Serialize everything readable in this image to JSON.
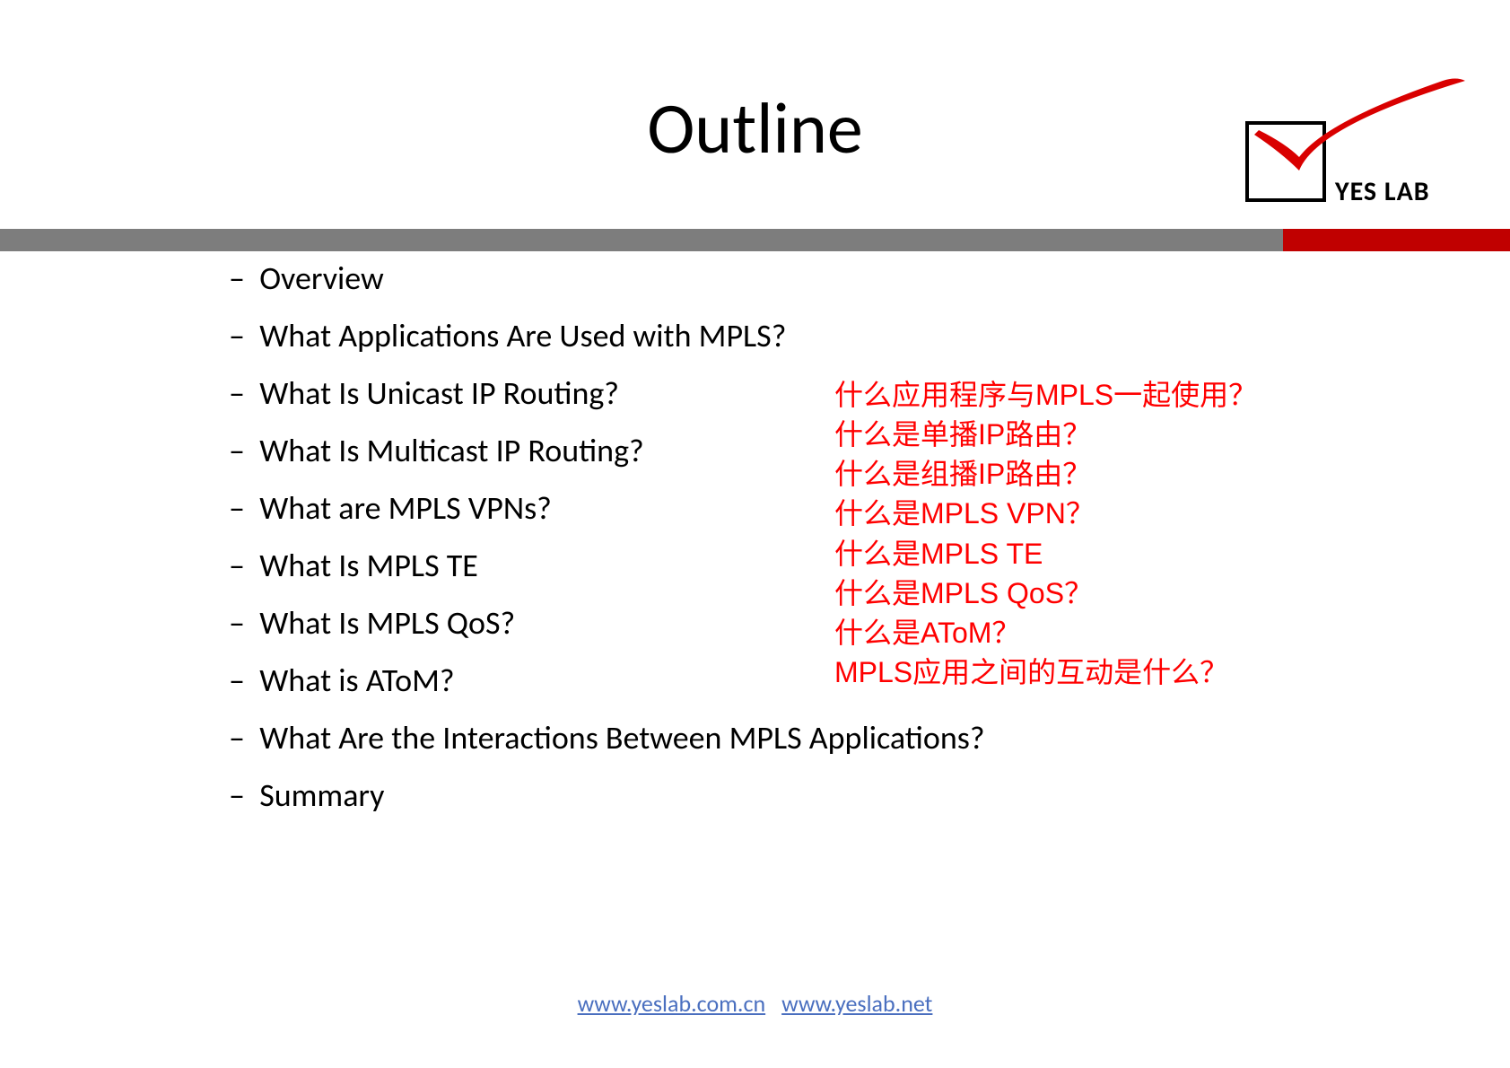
{
  "title": "Outline",
  "logo": {
    "text": "YES LAB"
  },
  "bullets": [
    "Overview",
    "What Applications Are Used with MPLS?",
    "What Is Unicast IP Routing?",
    "What Is Multicast IP Routing?",
    "What are MPLS VPNs?",
    "What Is MPLS TE",
    "What Is MPLS QoS?",
    "What is AToM?",
    "What Are the Interactions Between MPLS Applications?",
    "Summary"
  ],
  "side": [
    "什么应用程序与MPLS一起使用？",
    "什么是单播IP路由？",
    "什么是组播IP路由？",
    "什么是MPLS VPN？",
    "什么是MPLS TE",
    "什么是MPLS QoS？",
    "什么是AToM？",
    "MPLS应用之间的互动是什么？"
  ],
  "footer": {
    "link1": "www.yeslab.com.cn",
    "link2": "www.yeslab.net"
  }
}
